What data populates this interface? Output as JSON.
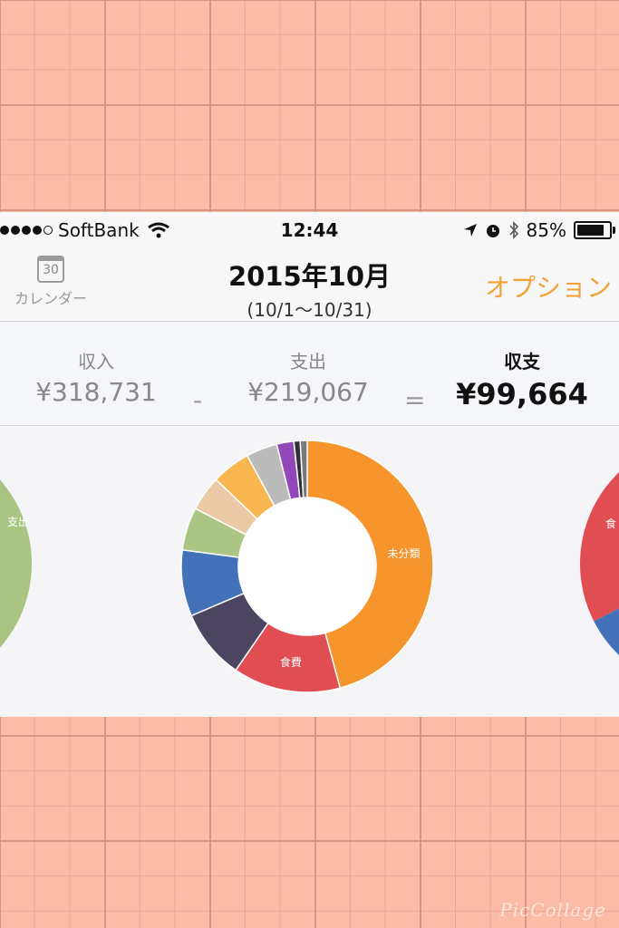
{
  "status_bar": {
    "carrier": "SoftBank",
    "time": "12:44",
    "battery": "85%",
    "battery_level": 0.85,
    "icons": [
      "signal-dots",
      "wifi-icon",
      "location-icon",
      "alarm-icon",
      "bluetooth-icon",
      "battery-icon"
    ]
  },
  "nav": {
    "calendar_label": "カレンダー",
    "calendar_day": "30",
    "title": "2015年10月",
    "subtitle": "(10/1〜10/31)",
    "option": "オプション"
  },
  "summary": {
    "income_label": "収入",
    "income_value": "¥318,731",
    "minus": "-",
    "expense_label": "支出",
    "expense_value": "¥219,067",
    "equals": "=",
    "net_label": "収支",
    "net_value": "¥99,664"
  },
  "chart_data": {
    "type": "pie",
    "slices": [
      {
        "label": "未分類",
        "value": 0.458,
        "color": "#f5952c"
      },
      {
        "label": "食費",
        "value": 0.138,
        "color": "#e04e54"
      },
      {
        "label": "",
        "value": 0.09,
        "color": "#4b4562"
      },
      {
        "label": "",
        "value": 0.085,
        "color": "#4472b8"
      },
      {
        "label": "",
        "value": 0.055,
        "color": "#aac584"
      },
      {
        "label": "",
        "value": 0.045,
        "color": "#ebc9a7"
      },
      {
        "label": "",
        "value": 0.05,
        "color": "#f8b651"
      },
      {
        "label": "",
        "value": 0.04,
        "color": "#bbbbbb"
      },
      {
        "label": "",
        "value": 0.022,
        "color": "#9248b8"
      },
      {
        "label": "",
        "value": 0.008,
        "color": "#2f2f3a"
      },
      {
        "label": "",
        "value": 0.009,
        "color": "#7a7a7a"
      }
    ],
    "side_left": {
      "label": "支出",
      "color": "#a9c483"
    },
    "side_right": {
      "label": "食",
      "colors": [
        "#e04e54",
        "#4472b8"
      ]
    }
  },
  "watermark": "PicCollage"
}
